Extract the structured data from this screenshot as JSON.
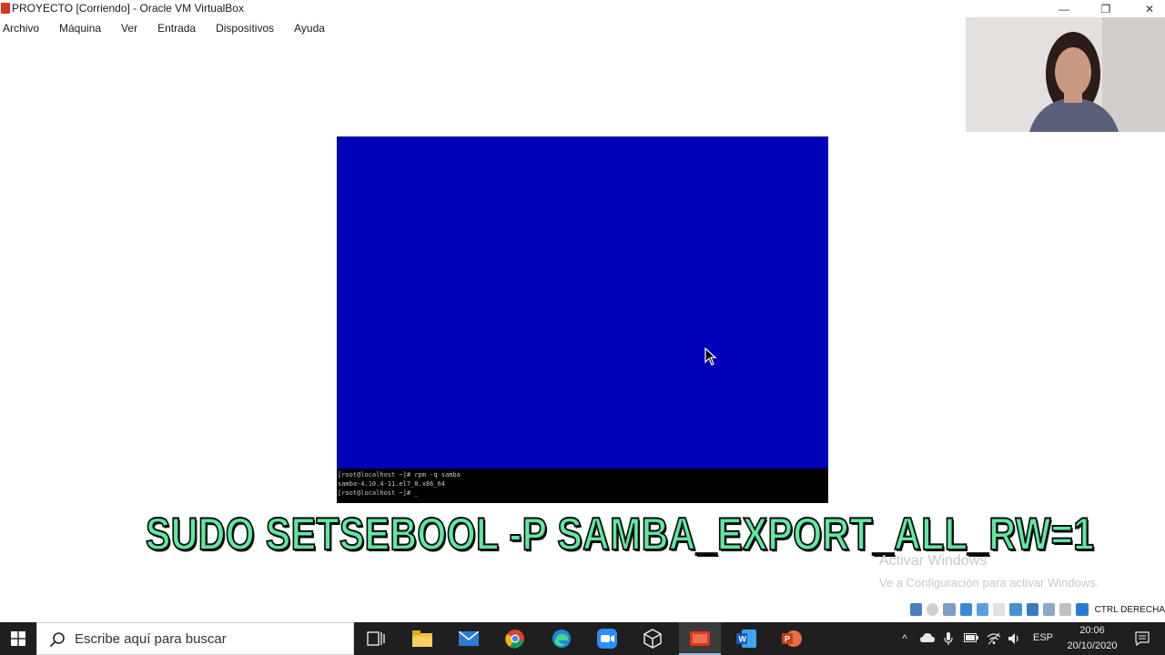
{
  "window": {
    "title": "PROYECTO [Corriendo] - Oracle VM VirtualBox",
    "minimize_glyph": "—",
    "maximize_glyph": "❐",
    "close_glyph": "✕"
  },
  "menu": {
    "items": [
      "Archivo",
      "Máquina",
      "Ver",
      "Entrada",
      "Dispositivos",
      "Ayuda"
    ]
  },
  "vm": {
    "console_lines": [
      "[root@localhost ~]# rpm -q samba",
      "samba-4.10.4-11.el7_8.x86_64",
      "[root@localhost ~]# _"
    ],
    "background_color": "#0000b8"
  },
  "caption": {
    "text": "SUDO SETSEBOOL -P  SAMBA_EXPORT_ALL_RW=1",
    "color": "#5ee8a0"
  },
  "watermark": {
    "title": "Activar Windows",
    "subtitle": "Ve a Configuración para activar Windows."
  },
  "statusbar": {
    "host_key": "CTRL DERECHA"
  },
  "taskbar": {
    "search_placeholder": "Escribe aquí para buscar",
    "language": "ESP",
    "time": "20:06",
    "date": "20/10/2020"
  }
}
